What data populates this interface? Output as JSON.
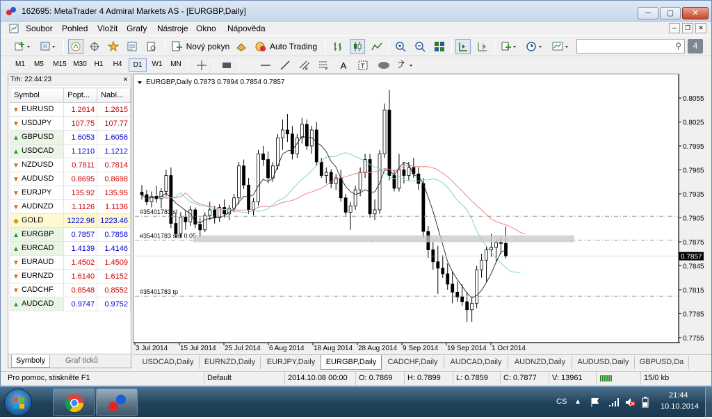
{
  "window": {
    "title": "162695: MetaTrader 4 Admiral Markets AS - [EURGBP,Daily]",
    "controls": {
      "minimize": "─",
      "maximize": "▢",
      "close": "✕"
    }
  },
  "menu": [
    "Soubor",
    "Pohled",
    "Vložit",
    "Grafy",
    "Nástroje",
    "Okno",
    "Nápověda"
  ],
  "toolbar": {
    "new_order": "Nový pokyn",
    "auto_trading": "Auto Trading",
    "search_placeholder": "",
    "search_badge": "4"
  },
  "timeframes": [
    "M1",
    "M5",
    "M15",
    "M30",
    "H1",
    "H4",
    "D1",
    "W1",
    "MN"
  ],
  "active_timeframe": "D1",
  "market_watch": {
    "header": "Trh: 22:44:23",
    "col_symbol": "Symbol",
    "col_bid": "Popt...",
    "col_ask": "Nabí...",
    "rows": [
      {
        "symbol": "EURUSD",
        "bid": "1.2614",
        "ask": "1.2615",
        "dir": "down",
        "color": "#d00000"
      },
      {
        "symbol": "USDJPY",
        "bid": "107.75",
        "ask": "107.77",
        "dir": "down",
        "color": "#d00000"
      },
      {
        "symbol": "GBPUSD",
        "bid": "1.6053",
        "ask": "1.6056",
        "dir": "up",
        "color": "#0000d0"
      },
      {
        "symbol": "USDCAD",
        "bid": "1.1210",
        "ask": "1.1212",
        "dir": "up",
        "color": "#0000d0"
      },
      {
        "symbol": "NZDUSD",
        "bid": "0.7811",
        "ask": "0.7814",
        "dir": "down",
        "color": "#d00000"
      },
      {
        "symbol": "AUDUSD",
        "bid": "0.8695",
        "ask": "0.8698",
        "dir": "down",
        "color": "#d00000"
      },
      {
        "symbol": "EURJPY",
        "bid": "135.92",
        "ask": "135.95",
        "dir": "down",
        "color": "#d00000"
      },
      {
        "symbol": "AUDNZD",
        "bid": "1.1126",
        "ask": "1.1136",
        "dir": "down",
        "color": "#d00000"
      },
      {
        "symbol": "GOLD",
        "bid": "1222.96",
        "ask": "1223.46",
        "dir": "gold",
        "color": "#0000d0"
      },
      {
        "symbol": "EURGBP",
        "bid": "0.7857",
        "ask": "0.7858",
        "dir": "up",
        "color": "#0000d0"
      },
      {
        "symbol": "EURCAD",
        "bid": "1.4139",
        "ask": "1.4146",
        "dir": "up",
        "color": "#0000d0"
      },
      {
        "symbol": "EURAUD",
        "bid": "1.4502",
        "ask": "1.4509",
        "dir": "down",
        "color": "#d00000"
      },
      {
        "symbol": "EURNZD",
        "bid": "1.6140",
        "ask": "1.6152",
        "dir": "down",
        "color": "#d00000"
      },
      {
        "symbol": "CADCHF",
        "bid": "0.8548",
        "ask": "0.8552",
        "dir": "down",
        "color": "#d00000"
      },
      {
        "symbol": "AUDCAD",
        "bid": "0.9747",
        "ask": "0.9752",
        "dir": "up",
        "color": "#0000d0"
      }
    ],
    "tabs": [
      "Symboly",
      "Graf ticků"
    ]
  },
  "chart": {
    "header": "EURGBP,Daily  0.7873 0.7894 0.7854 0.7857",
    "y_ticks": [
      "0.8055",
      "0.8025",
      "0.7995",
      "0.7965",
      "0.7935",
      "0.7905",
      "0.7875",
      "0.7845",
      "0.7815",
      "0.7785",
      "0.7755"
    ],
    "y_tick_values": [
      0.8055,
      0.8025,
      0.7995,
      0.7965,
      0.7935,
      0.7905,
      0.7875,
      0.7845,
      0.7815,
      0.7785,
      0.7755
    ],
    "x_ticks": [
      "3 Jul 2014",
      "15 Jul 2014",
      "25 Jul 2014",
      "6 Aug 2014",
      "18 Aug 2014",
      "28 Aug 2014",
      "9 Sep 2014",
      "19 Sep 2014",
      "1 Oct 2014"
    ],
    "current_price": "0.7857",
    "current_price_value": 0.7857,
    "order_lines": [
      {
        "label": "#35401783 sl",
        "price": 0.7907
      },
      {
        "label": "#35401783 sell 0.05",
        "price": 0.7877
      },
      {
        "label": "#35401783 tp",
        "price": 0.7807
      }
    ]
  },
  "chart_data": {
    "type": "candlestick",
    "title": "EURGBP,Daily",
    "ylim": [
      0.775,
      0.808
    ],
    "candles": [
      [
        0.7937,
        0.7946,
        0.7928,
        0.7934
      ],
      [
        0.7934,
        0.794,
        0.7921,
        0.7925
      ],
      [
        0.7925,
        0.7938,
        0.7918,
        0.7932
      ],
      [
        0.7932,
        0.7945,
        0.7924,
        0.7929
      ],
      [
        0.7929,
        0.7942,
        0.7917,
        0.7938
      ],
      [
        0.7938,
        0.7965,
        0.7932,
        0.7958
      ],
      [
        0.7958,
        0.7968,
        0.7892,
        0.7898
      ],
      [
        0.7898,
        0.791,
        0.788,
        0.7885
      ],
      [
        0.7885,
        0.7912,
        0.788,
        0.7906
      ],
      [
        0.7906,
        0.7915,
        0.789,
        0.79
      ],
      [
        0.79,
        0.792,
        0.7895,
        0.7915
      ],
      [
        0.7915,
        0.7918,
        0.7892,
        0.7897
      ],
      [
        0.7897,
        0.7905,
        0.788,
        0.789
      ],
      [
        0.789,
        0.7912,
        0.7887,
        0.7908
      ],
      [
        0.7908,
        0.7925,
        0.7902,
        0.7915
      ],
      [
        0.7915,
        0.792,
        0.7898,
        0.7905
      ],
      [
        0.7905,
        0.7922,
        0.79,
        0.7918
      ],
      [
        0.7918,
        0.7928,
        0.7905,
        0.791
      ],
      [
        0.791,
        0.7921,
        0.7902,
        0.7917
      ],
      [
        0.7917,
        0.7935,
        0.7912,
        0.793
      ],
      [
        0.793,
        0.7975,
        0.7922,
        0.797
      ],
      [
        0.797,
        0.7978,
        0.7941,
        0.7946
      ],
      [
        0.7946,
        0.7955,
        0.791,
        0.7915
      ],
      [
        0.7915,
        0.793,
        0.7908,
        0.7925
      ],
      [
        0.7925,
        0.799,
        0.792,
        0.7985
      ],
      [
        0.7985,
        0.7995,
        0.797,
        0.7978
      ],
      [
        0.7978,
        0.7988,
        0.7948,
        0.7955
      ],
      [
        0.7955,
        0.7975,
        0.795,
        0.797
      ],
      [
        0.797,
        0.801,
        0.7965,
        0.8005
      ],
      [
        0.8005,
        0.8028,
        0.799,
        0.8015
      ],
      [
        0.8015,
        0.8035,
        0.8,
        0.801
      ],
      [
        0.801,
        0.802,
        0.7978,
        0.7985
      ],
      [
        0.7985,
        0.801,
        0.798,
        0.8005
      ],
      [
        0.8005,
        0.803,
        0.7998,
        0.8022
      ],
      [
        0.8022,
        0.8028,
        0.799,
        0.7995
      ],
      [
        0.7995,
        0.802,
        0.7985,
        0.8015
      ],
      [
        0.8015,
        0.8025,
        0.797,
        0.7975
      ],
      [
        0.7975,
        0.798,
        0.7955,
        0.7958
      ],
      [
        0.7958,
        0.7968,
        0.7948,
        0.7962
      ],
      [
        0.7962,
        0.7966,
        0.7942,
        0.7948
      ],
      [
        0.7948,
        0.796,
        0.794,
        0.7955
      ],
      [
        0.7955,
        0.7965,
        0.7925,
        0.793
      ],
      [
        0.793,
        0.7935,
        0.7908,
        0.7912
      ],
      [
        0.7912,
        0.7925,
        0.789,
        0.792
      ],
      [
        0.792,
        0.7945,
        0.7915,
        0.794
      ],
      [
        0.794,
        0.7968,
        0.7932,
        0.7962
      ],
      [
        0.7962,
        0.7985,
        0.7955,
        0.7978
      ],
      [
        0.7978,
        0.7985,
        0.7905,
        0.791
      ],
      [
        0.791,
        0.7928,
        0.7902,
        0.7915
      ],
      [
        0.7915,
        0.799,
        0.791,
        0.7985
      ],
      [
        0.7985,
        0.8048,
        0.798,
        0.804
      ],
      [
        0.804,
        0.8065,
        0.7952,
        0.7958
      ],
      [
        0.7958,
        0.7965,
        0.7938,
        0.7942
      ],
      [
        0.7942,
        0.7985,
        0.7938,
        0.7965
      ],
      [
        0.7965,
        0.7975,
        0.7948,
        0.7958
      ],
      [
        0.7958,
        0.7975,
        0.7952,
        0.7968
      ],
      [
        0.7968,
        0.798,
        0.7955,
        0.796
      ],
      [
        0.796,
        0.7968,
        0.794,
        0.7948
      ],
      [
        0.7948,
        0.7955,
        0.788,
        0.7888
      ],
      [
        0.7888,
        0.7895,
        0.7855,
        0.7865
      ],
      [
        0.7865,
        0.7875,
        0.784,
        0.785
      ],
      [
        0.785,
        0.787,
        0.781,
        0.7842
      ],
      [
        0.7842,
        0.7858,
        0.783,
        0.7835
      ],
      [
        0.7835,
        0.7848,
        0.7815,
        0.7822
      ],
      [
        0.7822,
        0.7838,
        0.7798,
        0.7812
      ],
      [
        0.7812,
        0.7825,
        0.78,
        0.7806
      ],
      [
        0.7806,
        0.7822,
        0.7795,
        0.78
      ],
      [
        0.78,
        0.7812,
        0.7775,
        0.779
      ],
      [
        0.779,
        0.7805,
        0.7775,
        0.7798
      ],
      [
        0.7798,
        0.7845,
        0.7792,
        0.784
      ],
      [
        0.784,
        0.786,
        0.783,
        0.7852
      ],
      [
        0.7852,
        0.787,
        0.7825,
        0.7865
      ],
      [
        0.7865,
        0.7885,
        0.7856,
        0.7868
      ],
      [
        0.7868,
        0.7878,
        0.785,
        0.7874
      ],
      [
        0.7874,
        0.7882,
        0.786,
        0.7873
      ],
      [
        0.7873,
        0.7894,
        0.7854,
        0.7857
      ]
    ]
  },
  "chart_tabs": [
    "USDCAD,Daily",
    "EURNZD,Daily",
    "EURJPY,Daily",
    "EURGBP,Daily",
    "CADCHF,Daily",
    "AUDCAD,Daily",
    "AUDNZD,Daily",
    "AUDUSD,Daily",
    "GBPUSD,Da"
  ],
  "active_chart_tab": "EURGBP,Daily",
  "status": {
    "help": "Pro pomoc, stiskněte F1",
    "profile": "Default",
    "datetime": "2014.10.08 00:00",
    "open": "O: 0.7869",
    "high": "H: 0.7899",
    "low": "L: 0.7859",
    "close": "C: 0.7877",
    "volume": "V: 13961",
    "traffic": "15/0 kb"
  },
  "taskbar": {
    "lang": "CS",
    "time": "21:44",
    "date": "10.10.2014"
  },
  "colors": {
    "bull": "#ffffff",
    "bear": "#000000",
    "ma_red": "#f08080",
    "ma_cyan": "#7fd4d4",
    "ma_dark": "#202020"
  }
}
